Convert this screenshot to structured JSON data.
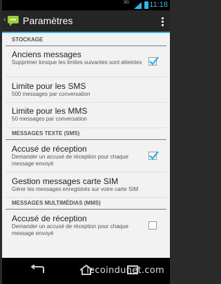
{
  "status_bar": {
    "network": "3G",
    "time": "11:18"
  },
  "action_bar": {
    "title": "Paramètres"
  },
  "sections": [
    {
      "header": "STOCKAGE",
      "items": [
        {
          "title": "Anciens messages",
          "summary": "Supprimer lorsque les limites suivantes sont atteintes",
          "checkbox": true,
          "checked": true
        },
        {
          "title": "Limite pour les SMS",
          "summary": "500 messages par conversation"
        },
        {
          "title": "Limite pour les MMS",
          "summary": "50 messages par conversation"
        }
      ]
    },
    {
      "header": "MESSAGES TEXTE (SMS)",
      "items": [
        {
          "title": "Accusé de réception",
          "summary": "Demander un accusé de réception pour chaque message envoyé",
          "checkbox": true,
          "checked": true
        },
        {
          "title": "Gestion messages carte SIM",
          "summary": "Gérer les messages enregistrés sur votre carte SIM"
        }
      ]
    },
    {
      "header": "MESSAGES MULTIMÉDIAS (MMS)",
      "items": [
        {
          "title": "Accusé de réception",
          "summary": "Demander un accusé de réception pour chaque message envoyé",
          "checkbox": true,
          "checked": false
        }
      ]
    }
  ],
  "watermark": "lecoindunet.com",
  "colors": {
    "accent": "#33b5e5",
    "action_bar": "#262626",
    "background": "#f2f2f2"
  },
  "icons": {
    "app": "messaging-app-icon",
    "up": "back-caret-icon",
    "overflow": "overflow-menu-icon",
    "nav_back": "back-icon",
    "nav_home": "home-icon",
    "nav_recents": "recents-icon"
  }
}
